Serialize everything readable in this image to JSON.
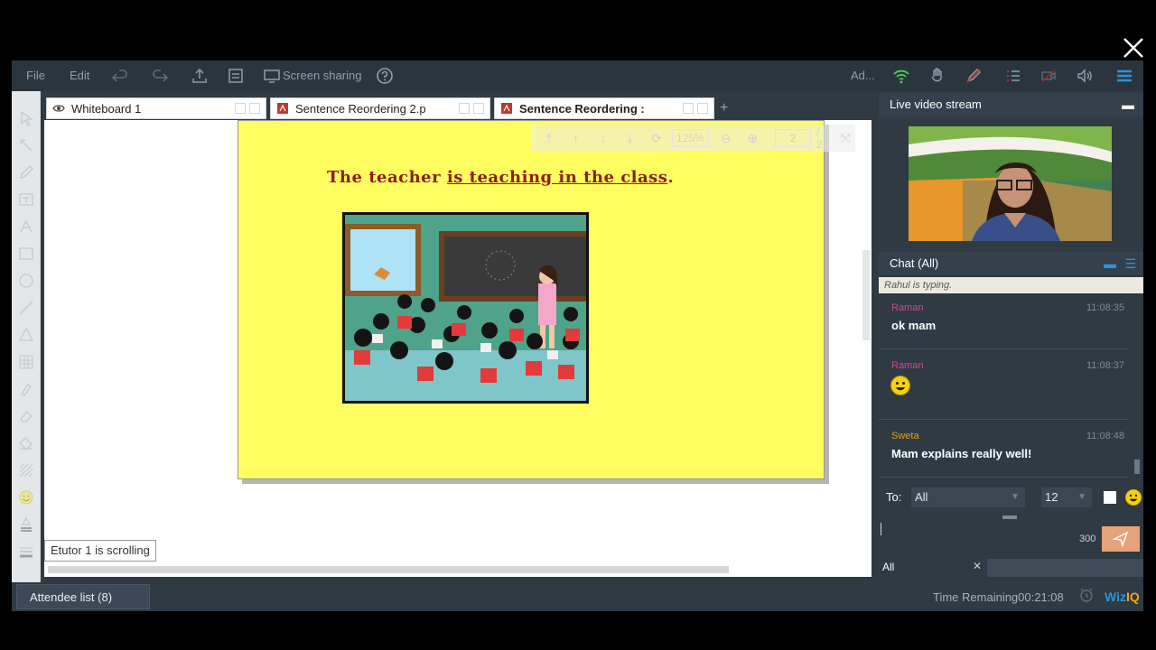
{
  "toolbar": {
    "file": "File",
    "edit": "Edit",
    "screen_sharing": "Screen sharing",
    "admin_short": "Ad..."
  },
  "tabs": [
    {
      "label": "Whiteboard 1",
      "icon": "eye-icon"
    },
    {
      "label": "Sentence Reordering 2.p",
      "icon": "pdf-icon"
    },
    {
      "label": "Sentence Reordering :",
      "icon": "pdf-icon",
      "active": true
    }
  ],
  "slide": {
    "sentence_start": "The teacher ",
    "sentence_underlined": "is teaching in the class",
    "sentence_end": "."
  },
  "pdf_toolbar": {
    "zoom": "125%",
    "page": "2",
    "total": "/ 2"
  },
  "status_note": "Etutor 1 is scrolling",
  "bottom": {
    "attendee_list": "Attendee list (8)",
    "time_remaining": "Time Remaining00:21:08",
    "logo_a": "Wiz",
    "logo_b": "IQ"
  },
  "video": {
    "title": "Live video stream"
  },
  "chat": {
    "title": "Chat (All)",
    "typing": "Rahul is typing.",
    "messages": [
      {
        "sender": "Raman",
        "time": "11:08:35",
        "text": "ok mam",
        "sender_color": "#d4478f"
      },
      {
        "sender": "Raman",
        "time": "11:08:37",
        "text": "",
        "emoji": true,
        "sender_color": "#d4478f"
      },
      {
        "sender": "Sweta",
        "time": "11:08:48",
        "text": "Mam explains really well!",
        "sender_color": "#e0a020"
      }
    ],
    "to_label": "To:",
    "to_value": "All",
    "font_size": "12",
    "char_count": "300",
    "tab_all": "All"
  },
  "colors": {
    "accent": "#2f93d4",
    "wifi": "#4fd14f",
    "slide_bg": "#fffd5f",
    "send": "#e6a37a"
  }
}
